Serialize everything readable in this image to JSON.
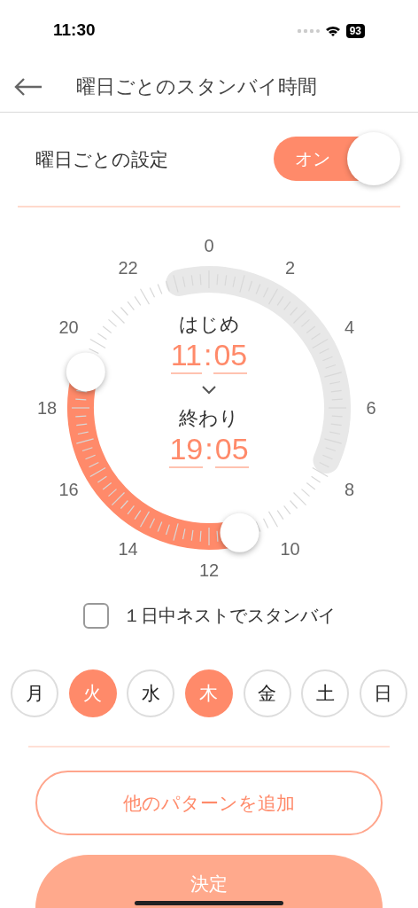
{
  "status_bar": {
    "time": "11:30",
    "battery": "93"
  },
  "header": {
    "title": "曜日ごとのスタンバイ時間"
  },
  "setting": {
    "label": "曜日ごとの設定",
    "toggle": {
      "label": "オン",
      "on": true
    }
  },
  "dial": {
    "hour_labels": [
      "0",
      "2",
      "4",
      "6",
      "8",
      "10",
      "12",
      "14",
      "16",
      "18",
      "20",
      "22"
    ],
    "start": {
      "label": "はじめ",
      "hour": "11",
      "separator": ":",
      "minute": "05"
    },
    "end": {
      "label": "終わり",
      "hour": "19",
      "separator": ":",
      "minute": "05"
    }
  },
  "all_day": {
    "label": "１日中ネストでスタンバイ",
    "checked": false
  },
  "days": [
    {
      "label": "月",
      "selected": false
    },
    {
      "label": "火",
      "selected": true
    },
    {
      "label": "水",
      "selected": false
    },
    {
      "label": "木",
      "selected": true
    },
    {
      "label": "金",
      "selected": false
    },
    {
      "label": "土",
      "selected": false
    },
    {
      "label": "日",
      "selected": false
    }
  ],
  "buttons": [
    {
      "label": "他のパターンを追加",
      "kind": "outline"
    },
    {
      "label": "決定",
      "kind": "filled"
    }
  ]
}
